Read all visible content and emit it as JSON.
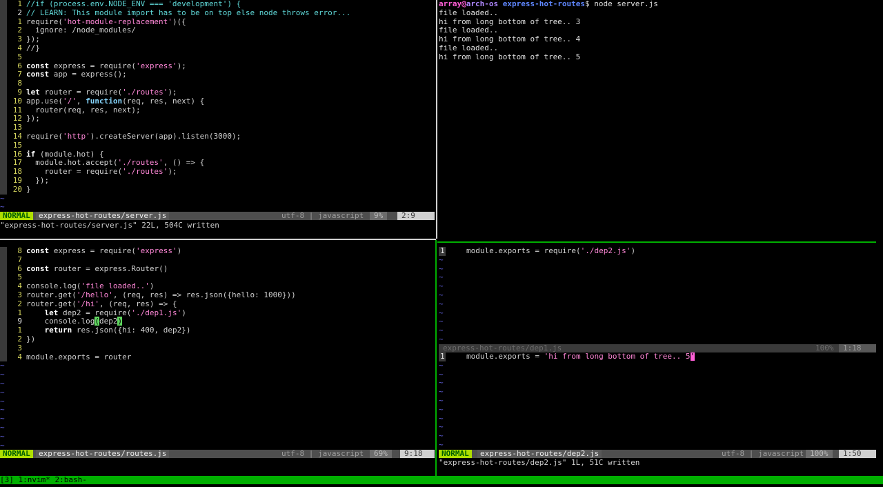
{
  "colors": {
    "tmux_bar": "#00af00",
    "active_border": "#00af00",
    "mode_bg": "#afdf00"
  },
  "pane_tl": {
    "lines": [
      {
        "n": "1",
        "cur": false,
        "html": "<span class=\"c\">//if (process.env.NODE_ENV === 'development') {</span>"
      },
      {
        "n": "2",
        "cur": true,
        "html": "<span class=\"c\">// LEARN: This module import has to be on top else node throws error...</span>"
      },
      {
        "n": "1",
        "cur": false,
        "html": "require(<span class=\"s\">'hot-module-replacement'</span>)({"
      },
      {
        "n": "2",
        "cur": false,
        "html": "  ignore: /node_modules/"
      },
      {
        "n": "3",
        "cur": false,
        "html": "});"
      },
      {
        "n": "4",
        "cur": false,
        "html": "//}"
      },
      {
        "n": "5",
        "cur": false,
        "html": ""
      },
      {
        "n": "6",
        "cur": false,
        "html": "<span class=\"k\">const</span> express = require(<span class=\"s\">'express'</span>);"
      },
      {
        "n": "7",
        "cur": false,
        "html": "<span class=\"k\">const</span> app = express();"
      },
      {
        "n": "8",
        "cur": false,
        "html": ""
      },
      {
        "n": "9",
        "cur": false,
        "html": "<span class=\"k\">let</span> router = require(<span class=\"s\">'./routes'</span>);"
      },
      {
        "n": "10",
        "cur": false,
        "html": "app.use(<span class=\"s\">'/'</span>, <span class=\"f\">function</span>(req, res, next) {"
      },
      {
        "n": "11",
        "cur": false,
        "html": "  router(req, res, next);"
      },
      {
        "n": "12",
        "cur": false,
        "html": "});"
      },
      {
        "n": "13",
        "cur": false,
        "html": ""
      },
      {
        "n": "14",
        "cur": false,
        "html": "require(<span class=\"s\">'http'</span>).createServer(app).listen(3000);"
      },
      {
        "n": "15",
        "cur": false,
        "html": ""
      },
      {
        "n": "16",
        "cur": false,
        "html": "<span class=\"k\">if</span> (module.hot) {"
      },
      {
        "n": "17",
        "cur": false,
        "html": "  module.hot.accept(<span class=\"s\">'./routes'</span>, () => {"
      },
      {
        "n": "18",
        "cur": false,
        "html": "    router = require(<span class=\"s\">'./routes'</span>);"
      },
      {
        "n": "19",
        "cur": false,
        "html": "  });"
      },
      {
        "n": "20",
        "cur": false,
        "html": "}"
      }
    ],
    "tildes": 2,
    "status": {
      "mode": "NORMAL",
      "file": "express-hot-routes/server.js",
      "enc": "utf-8 | javascript",
      "pct": "9%",
      "pos": "2:9"
    },
    "message": "\"express-hot-routes/server.js\" 22L, 504C written"
  },
  "pane_tr": {
    "prompt_user": "array",
    "prompt_at": "@",
    "prompt_host": "arch-os",
    "prompt_path": "express-hot-routes",
    "prompt_cmd": "$ node server.js",
    "output": [
      "file loaded..",
      "hi from long bottom of tree.. 3",
      "file loaded..",
      "hi from long bottom of tree.. 4",
      "file loaded..",
      "hi from long bottom of tree.. 5"
    ]
  },
  "pane_bl": {
    "lines": [
      {
        "n": "8",
        "cur": false,
        "html": "<span class=\"k\">const</span> express = require(<span class=\"s\">'express'</span>)"
      },
      {
        "n": "7",
        "cur": false,
        "html": ""
      },
      {
        "n": "6",
        "cur": false,
        "html": "<span class=\"k\">const</span> router = express.Router()"
      },
      {
        "n": "5",
        "cur": false,
        "html": ""
      },
      {
        "n": "4",
        "cur": false,
        "html": "console.log(<span class=\"s\">'file loaded..'</span>)"
      },
      {
        "n": "3",
        "cur": false,
        "html": "router.get(<span class=\"s\">'/hello'</span>, (req, res) => res.json({hello: 1000}))"
      },
      {
        "n": "2",
        "cur": false,
        "html": "router.get(<span class=\"s\">'/hi'</span>, (req, res) => {"
      },
      {
        "n": "1",
        "cur": false,
        "html": "    <span class=\"k\">let</span> dep2 = require(<span class=\"s\">'./dep1.js'</span>)"
      },
      {
        "n": "9",
        "cur": true,
        "html": "    console.log<span class=\"cur-ch\">(</span>dep2<span class=\"cur-ch\">)</span>"
      },
      {
        "n": "1",
        "cur": false,
        "html": "    <span class=\"k\">return</span> res.json({hi: 400, dep2})"
      },
      {
        "n": "2",
        "cur": false,
        "html": "})"
      },
      {
        "n": "3",
        "cur": false,
        "html": ""
      },
      {
        "n": "4",
        "cur": false,
        "html": "module.exports = router"
      }
    ],
    "tildes": 10,
    "status": {
      "mode": "NORMAL",
      "file": "express-hot-routes/routes.js",
      "enc": "utf-8 | javascript",
      "pct": "69%",
      "pos": "9:18"
    }
  },
  "pane_br_top": {
    "lines": [
      {
        "n": "1",
        "html": "module.exports = require(<span class=\"s\">'./dep2.js'</span>)"
      }
    ],
    "tildes": 10,
    "status": {
      "file": "express-hot-routes/dep1.js",
      "pct": "100%",
      "pos": "1:18"
    }
  },
  "pane_br_bot": {
    "lines": [
      {
        "n": "1",
        "html": "module.exports = <span class=\"s\">'hi from long bottom of tree.. 5</span><span class=\"cur-pink\">'</span>"
      }
    ],
    "tildes": 10,
    "status": {
      "mode": "NORMAL",
      "file": "express-hot-routes/dep2.js",
      "enc": "utf-8 | javascript",
      "pct": "100%",
      "pos": "1:50"
    },
    "message": "\"express-hot-routes/dep2.js\" 1L, 51C written"
  },
  "tmux": {
    "text": "[3] 1:nvim* 2:bash-"
  }
}
